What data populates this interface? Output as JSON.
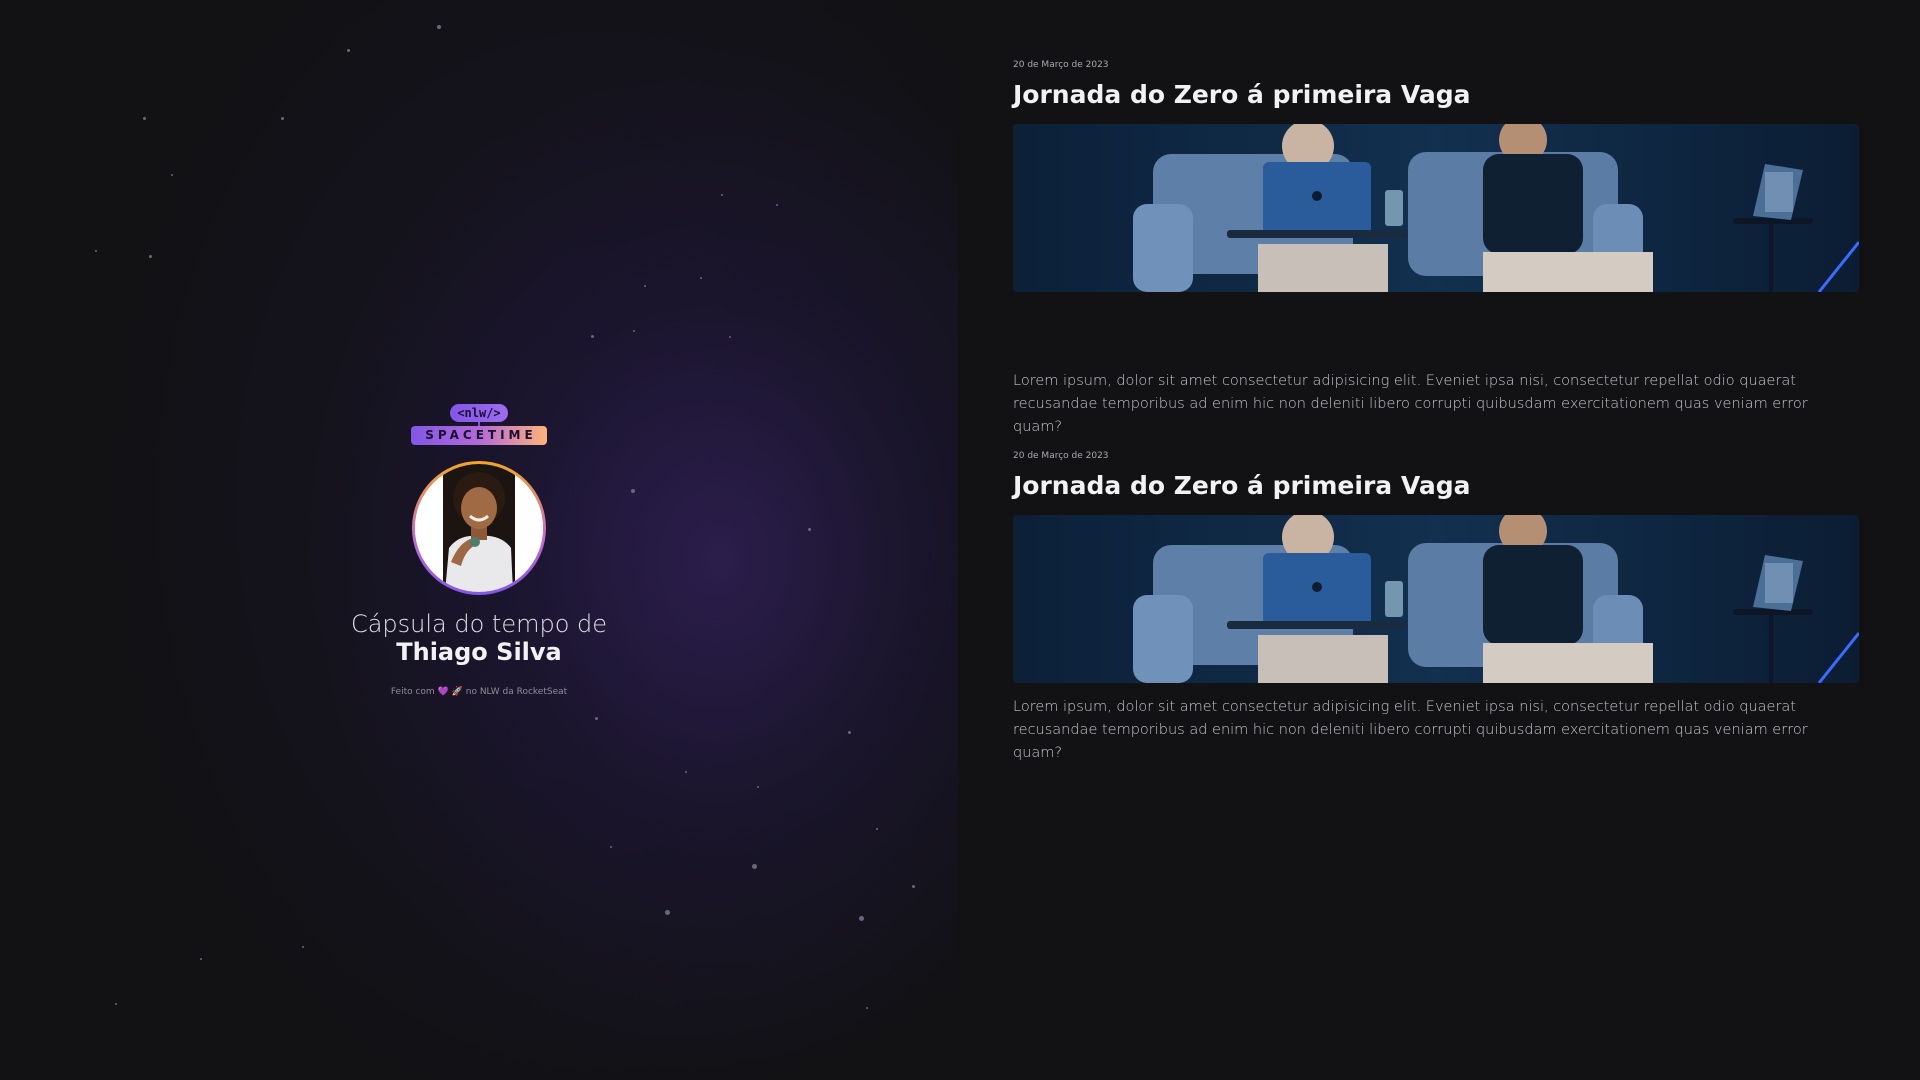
{
  "left_panel": {
    "logo": {
      "tag": "<nlw/>",
      "name": "SPACETIME"
    },
    "avatar_alt": "Thiago Silva avatar",
    "heading_prefix": "Cápsula do tempo de",
    "heading_name": "Thiago Silva",
    "footer": {
      "prefix": "Feito com",
      "heart": "💜",
      "rocket": "🚀",
      "suffix": "no NLW da RocketSeat"
    }
  },
  "memories": [
    {
      "date": "20 de Março de 2023",
      "title": "Jornada do Zero á primeira Vaga",
      "image_alt": "Duas pessoas sentadas em poltronas com um notebook",
      "text": "Lorem ipsum, dolor sit amet consectetur adipisicing elit. Eveniet ipsa nisi, consectetur repellat odio quaerat recusandae temporibus ad enim hic non deleniti libero corrupti quibusdam exercitationem quas veniam error quam?"
    },
    {
      "date": "20 de Março de 2023",
      "title": "Jornada do Zero á primeira Vaga",
      "image_alt": "Duas pessoas sentadas em poltronas com um notebook",
      "text": "Lorem ipsum, dolor sit amet consectetur adipisicing elit. Eveniet ipsa nisi, consectetur repellat odio quaerat recusandae temporibus ad enim hic non deleniti libero corrupti quibusdam exercitationem quas veniam error quam?"
    }
  ],
  "colors": {
    "background": "#121215",
    "accent_purple": "#8257e5",
    "accent_orange": "#ffb27a",
    "text_primary": "#f2f2f5",
    "text_secondary": "#c4c4cc"
  }
}
